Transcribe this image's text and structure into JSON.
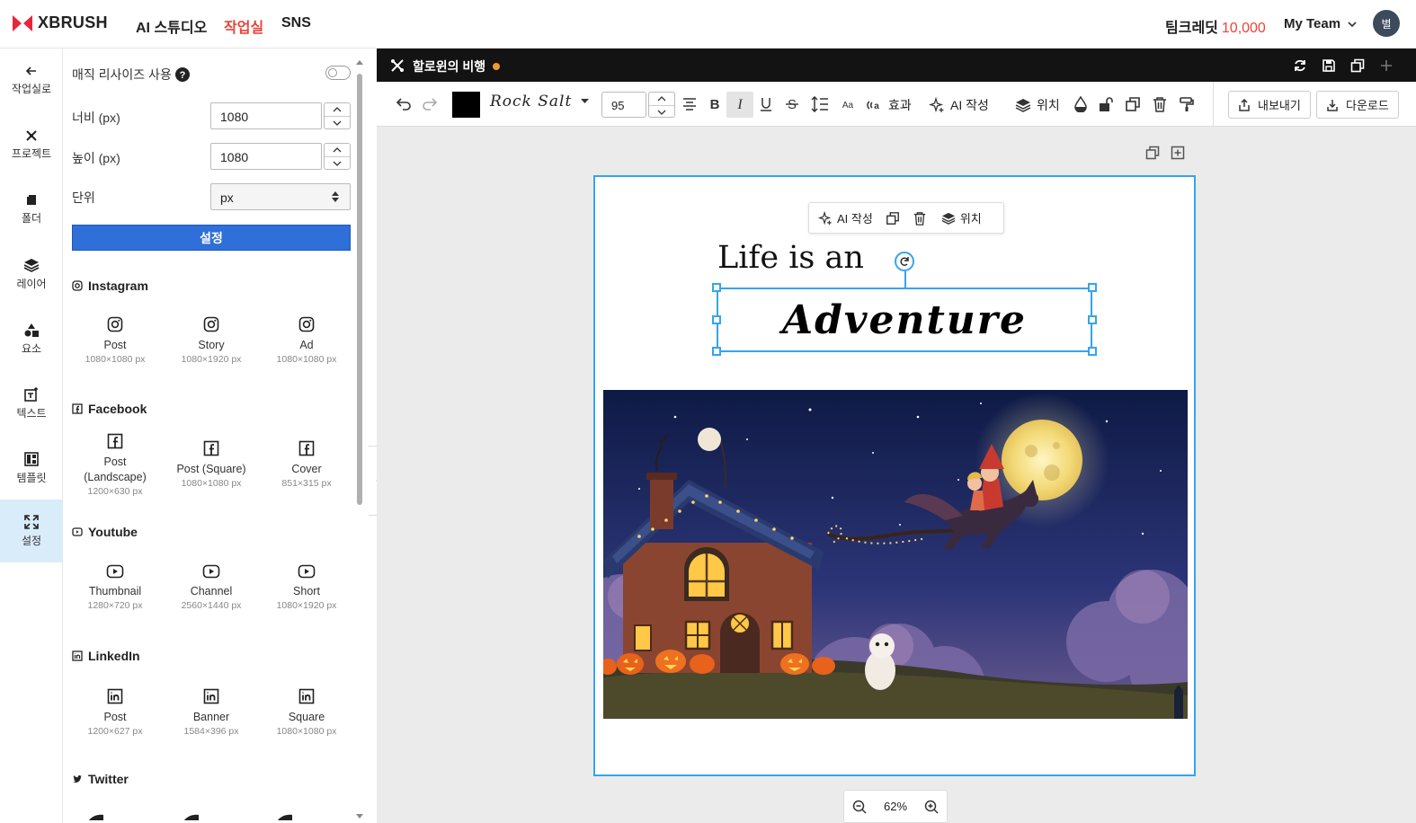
{
  "brand": {
    "name": "XBRUSH",
    "color": "#e8263b"
  },
  "topnav": {
    "ai_studio": "AI 스튜디오",
    "workroom": "작업실",
    "sns": "SNS",
    "active_color": "#e8443a"
  },
  "account": {
    "credit_label": "팀크레딧",
    "credit_value": "10,000",
    "team": "My Team",
    "avatar": "별"
  },
  "sidebar": [
    {
      "label": "작업실로",
      "icon": "arrow-left-icon"
    },
    {
      "label": "프로젝트",
      "icon": "project-icon"
    },
    {
      "label": "폴더",
      "icon": "folder-icon"
    },
    {
      "label": "레이어",
      "icon": "layers-icon"
    },
    {
      "label": "요소",
      "icon": "elements-icon"
    },
    {
      "label": "텍스트",
      "icon": "text-icon"
    },
    {
      "label": "템플릿",
      "icon": "template-icon"
    },
    {
      "label": "설정",
      "icon": "resize-icon",
      "active": true
    }
  ],
  "settings": {
    "magic_resize_label": "매직 리사이즈 사용",
    "magic_resize_on": false,
    "width_label": "너비 (px)",
    "width_value": "1080",
    "height_label": "높이 (px)",
    "height_value": "1080",
    "unit_label": "단위",
    "unit_value": "px",
    "apply_label": "설정"
  },
  "presets": {
    "instagram": {
      "title": "Instagram",
      "items": [
        {
          "name": "Post",
          "size": "1080×1080 px"
        },
        {
          "name": "Story",
          "size": "1080×1920 px"
        },
        {
          "name": "Ad",
          "size": "1080×1080 px"
        }
      ]
    },
    "facebook": {
      "title": "Facebook",
      "items": [
        {
          "name": "Post (Landscape)",
          "size": "1200×630 px"
        },
        {
          "name": "Post (Square)",
          "size": "1080×1080 px"
        },
        {
          "name": "Cover",
          "size": "851×315 px"
        }
      ]
    },
    "youtube": {
      "title": "Youtube",
      "items": [
        {
          "name": "Thumbnail",
          "size": "1280×720 px"
        },
        {
          "name": "Channel",
          "size": "2560×1440 px"
        },
        {
          "name": "Short",
          "size": "1080×1920 px"
        }
      ]
    },
    "linkedin": {
      "title": "LinkedIn",
      "items": [
        {
          "name": "Post",
          "size": "1200×627 px"
        },
        {
          "name": "Banner",
          "size": "1584×396 px"
        },
        {
          "name": "Square",
          "size": "1080×1080 px"
        }
      ]
    },
    "twitter": {
      "title": "Twitter"
    }
  },
  "document": {
    "title": "할로윈의 비행",
    "unsaved_color": "#f29a2e"
  },
  "toolbar": {
    "text_color": "#000000",
    "font_name": "Rock Salt",
    "font_size": "95",
    "effect_label": "효과",
    "ai_write_label": "AI 작성",
    "position_label": "위치",
    "export_label": "내보내기",
    "download_label": "다운로드"
  },
  "canvas": {
    "headline": "Life is an",
    "selected_text": "Adventure",
    "float_ai_label": "AI 작성",
    "float_position_label": "위치",
    "selection_color": "#36a4ec"
  },
  "zoom": {
    "value": "62%"
  }
}
